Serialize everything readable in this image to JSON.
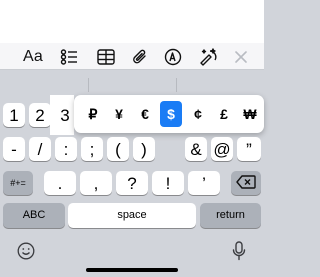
{
  "toolbar": {
    "format_label": "Aa",
    "icons": [
      "checklist-icon",
      "table-icon",
      "paperclip-icon",
      "pen-markup-icon",
      "magic-edit-icon",
      "close-icon"
    ]
  },
  "keyboard": {
    "row1": [
      "1",
      "2",
      "3"
    ],
    "popup_currency": [
      "₽",
      "¥",
      "€",
      "$",
      "¢",
      "£",
      "₩"
    ],
    "popup_selected": "$",
    "row2": [
      "-",
      "/",
      ":",
      ";",
      "(",
      ")",
      "&",
      "@",
      "”"
    ],
    "row3_left": "#+=",
    "row3": [
      ".",
      ",",
      "?",
      "!",
      "’"
    ],
    "abc_label": "ABC",
    "space_label": "space",
    "return_label": "return"
  },
  "colors": {
    "accent": "#1a7cf5",
    "keyboard_bg": "#d1d4da",
    "key_gray": "#acb1b9"
  }
}
